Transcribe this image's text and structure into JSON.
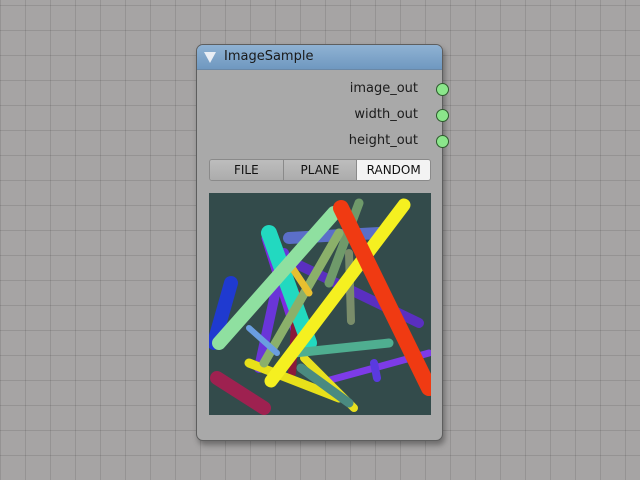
{
  "node": {
    "title": "ImageSample",
    "outputs": [
      {
        "label": "image_out"
      },
      {
        "label": "width_out"
      },
      {
        "label": "height_out"
      }
    ],
    "tabs": [
      {
        "label": "FILE",
        "active": false
      },
      {
        "label": "PLANE",
        "active": false
      },
      {
        "label": "RANDOM",
        "active": true
      }
    ]
  },
  "colors": {
    "header": "#7ea6cc",
    "socket": "#8be68b",
    "preview_bg": "#334b4b"
  }
}
